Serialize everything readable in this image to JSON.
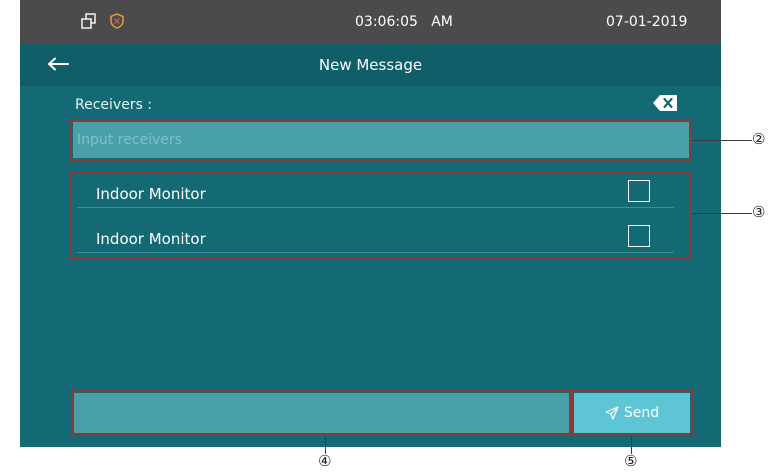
{
  "status_bar": {
    "time": "03:06:05   AM",
    "date": "07-01-2019",
    "icons": [
      "windows-icon",
      "shield-icon"
    ]
  },
  "header": {
    "title": "New Message",
    "back_icon": "arrow-left-icon"
  },
  "receivers": {
    "label": "Receivers :",
    "placeholder": "Input receivers",
    "clear_icon": "backspace-icon"
  },
  "receiver_list": {
    "items": [
      {
        "label": "Indoor Monitor",
        "checked": false
      },
      {
        "label": "Indoor Monitor",
        "checked": false
      }
    ]
  },
  "compose": {
    "value": "",
    "send_label": "Send",
    "send_icon": "paper-plane-icon"
  },
  "callouts": [
    "②",
    "③",
    "④",
    "⑤"
  ],
  "colors": {
    "background": "#146a74",
    "status_bar": "#4b4b4b",
    "title_bar": "#0f5e68",
    "input": "#4aa0a8",
    "send_button": "#5ec5d6",
    "annotation_border": "#8a3a3a"
  }
}
